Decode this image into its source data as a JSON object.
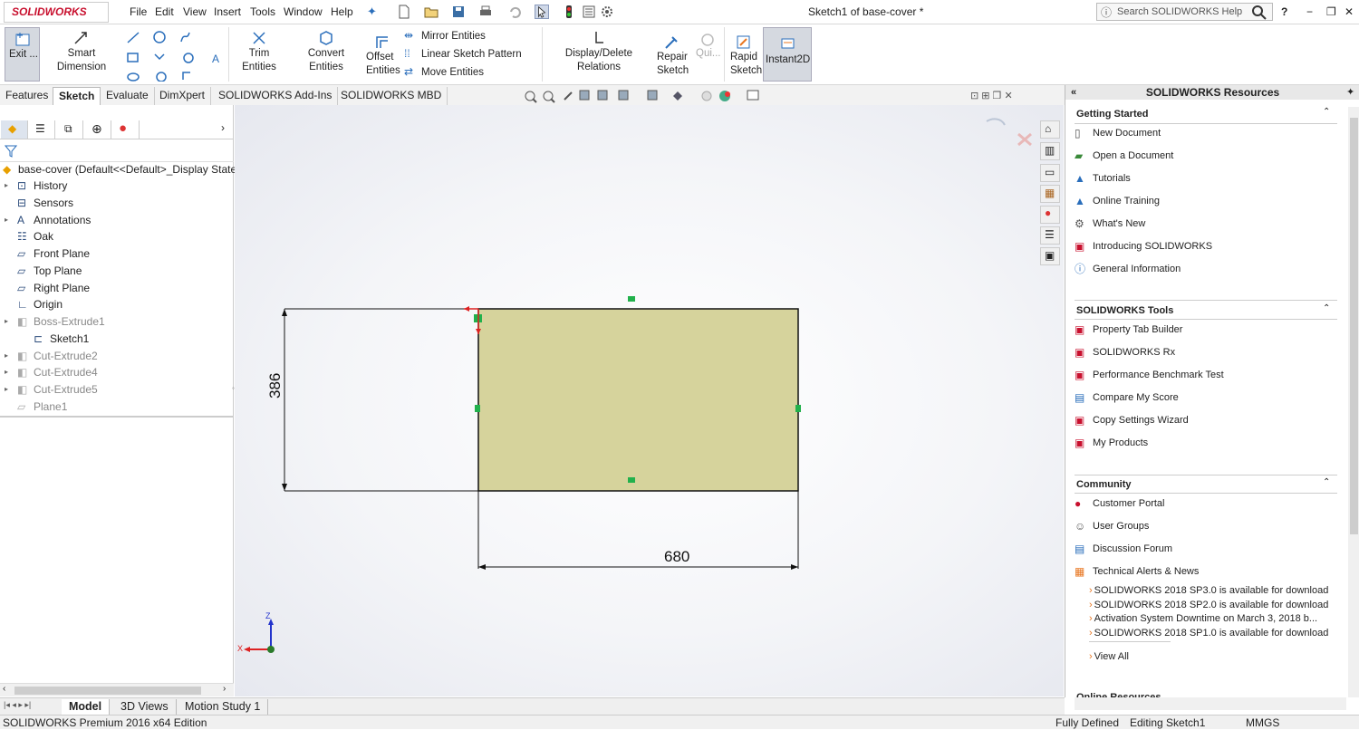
{
  "app": {
    "logo": "SOLIDWORKS",
    "title": "Sketch1 of base-cover *"
  },
  "menu": [
    "File",
    "Edit",
    "View",
    "Insert",
    "Tools",
    "Window",
    "Help"
  ],
  "search": {
    "placeholder": "Search SOLIDWORKS Help",
    "help_glyph": "?"
  },
  "commands": {
    "exit": "Exit ...",
    "smart_dimension": "Smart Dimension",
    "trim": "Trim Entities",
    "convert": "Convert Entities",
    "offset_line1": "Offset",
    "offset_line2": "Entities",
    "mirror": "Mirror Entities",
    "linear_pattern": "Linear Sketch Pattern",
    "move": "Move Entities",
    "relations": "Display/Delete Relations",
    "repair_line1": "Repair",
    "repair_line2": "Sketch",
    "quick": "Qui...",
    "rapid_line1": "Rapid",
    "rapid_line2": "Sketch",
    "instant2d": "Instant2D"
  },
  "tabs": [
    "Features",
    "Sketch",
    "Evaluate",
    "DimXpert",
    "SOLIDWORKS Add-Ins",
    "SOLIDWORKS MBD"
  ],
  "active_tab": "Sketch",
  "tree": {
    "root": "base-cover  (Default<<Default>_Display State",
    "items": [
      {
        "label": "History",
        "dim": false
      },
      {
        "label": "Sensors",
        "dim": false
      },
      {
        "label": "Annotations",
        "dim": false
      },
      {
        "label": "Oak",
        "dim": false
      },
      {
        "label": "Front Plane",
        "dim": false
      },
      {
        "label": "Top Plane",
        "dim": false
      },
      {
        "label": "Right Plane",
        "dim": false
      },
      {
        "label": "Origin",
        "dim": false
      },
      {
        "label": "Boss-Extrude1",
        "dim": true
      },
      {
        "label": "Sketch1",
        "dim": false
      },
      {
        "label": "Cut-Extrude2",
        "dim": true
      },
      {
        "label": "Cut-Extrude4",
        "dim": true
      },
      {
        "label": "Cut-Extrude5",
        "dim": true
      },
      {
        "label": "Plane1",
        "dim": true
      }
    ]
  },
  "sketch": {
    "height_dim": "386",
    "width_dim": "680",
    "triad_x": "X",
    "triad_z": "Z"
  },
  "resources": {
    "title": "SOLIDWORKS Resources",
    "getting_started": {
      "header": "Getting Started",
      "items": [
        "New Document",
        "Open a Document",
        "Tutorials",
        "Online Training",
        "What's New",
        "Introducing SOLIDWORKS",
        "General Information"
      ]
    },
    "tools": {
      "header": "SOLIDWORKS Tools",
      "items": [
        "Property Tab Builder",
        "SOLIDWORKS Rx",
        "Performance Benchmark Test",
        "Compare My Score",
        "Copy Settings Wizard",
        "My Products"
      ]
    },
    "community": {
      "header": "Community",
      "items": [
        "Customer Portal",
        "User Groups",
        "Discussion Forum",
        "Technical Alerts & News"
      ]
    },
    "news": [
      "SOLIDWORKS 2018 SP3.0 is available for download",
      "SOLIDWORKS 2018 SP2.0 is available for download",
      "Activation System Downtime on March 3, 2018 b...",
      "SOLIDWORKS 2018 SP1.0 is available for download"
    ],
    "view_all": "View All",
    "online_resources": "Online Resources"
  },
  "bottom_tabs": [
    "Model",
    "3D Views",
    "Motion Study 1"
  ],
  "status": {
    "edition": "SOLIDWORKS Premium 2016 x64 Edition",
    "defined": "Fully Defined",
    "editing": "Editing Sketch1",
    "units": "MMGS"
  },
  "colors": {
    "sketch_fill": "#d6d39c",
    "brand_red": "#c8102e",
    "relation_green": "#22b14c"
  }
}
